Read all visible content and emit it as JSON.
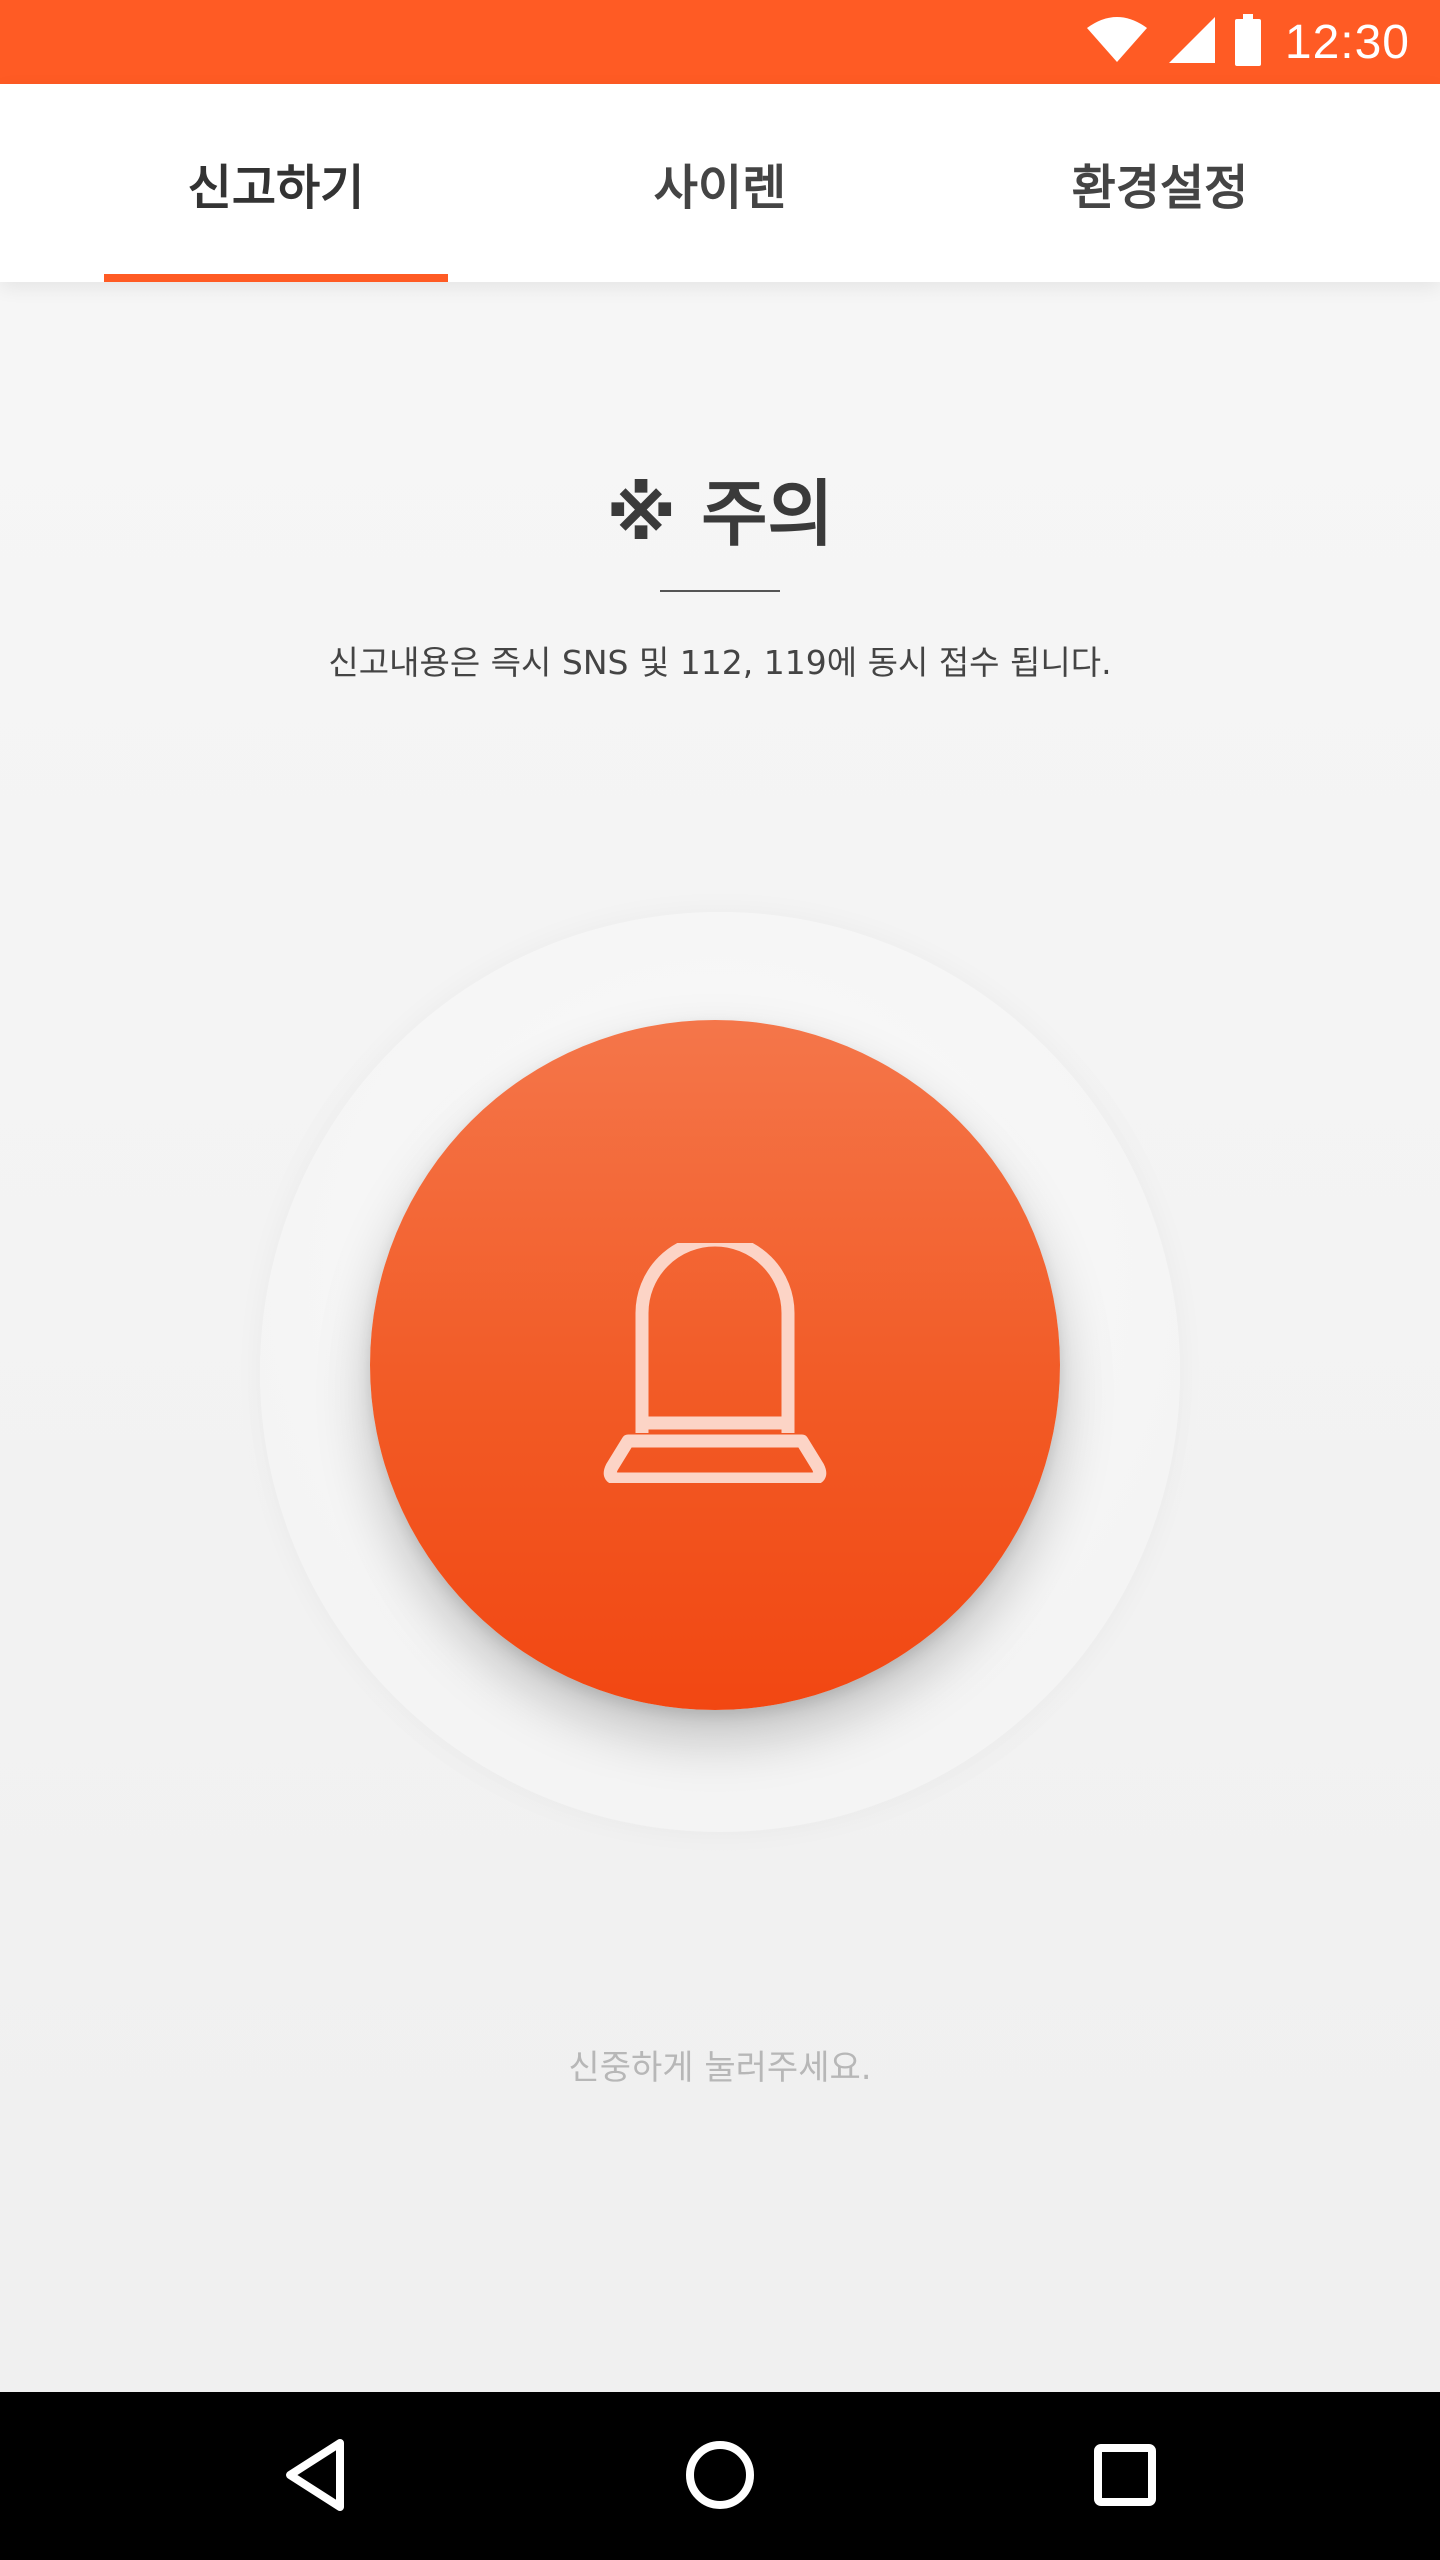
{
  "status_bar": {
    "time": "12:30",
    "icons": [
      "wifi-icon",
      "cell-signal-icon",
      "battery-icon"
    ],
    "color": "#ff5b24"
  },
  "tabs": [
    {
      "label": "신고하기",
      "active": true
    },
    {
      "label": "사이렌",
      "active": false
    },
    {
      "label": "환경설정",
      "active": false
    }
  ],
  "warning": {
    "title": "※ 주의",
    "text": "신고내용은 즉시 SNS 및 112, 119에 동시 접수 됩니다."
  },
  "siren_button": {
    "icon": "siren-icon",
    "color": "#f25a25"
  },
  "hint": "신중하게 눌러주세요.",
  "nav_bar": {
    "icons": [
      "back-icon",
      "home-icon",
      "recents-icon"
    ]
  },
  "colors": {
    "accent": "#ff5b24",
    "background": "#f2f2f2"
  }
}
